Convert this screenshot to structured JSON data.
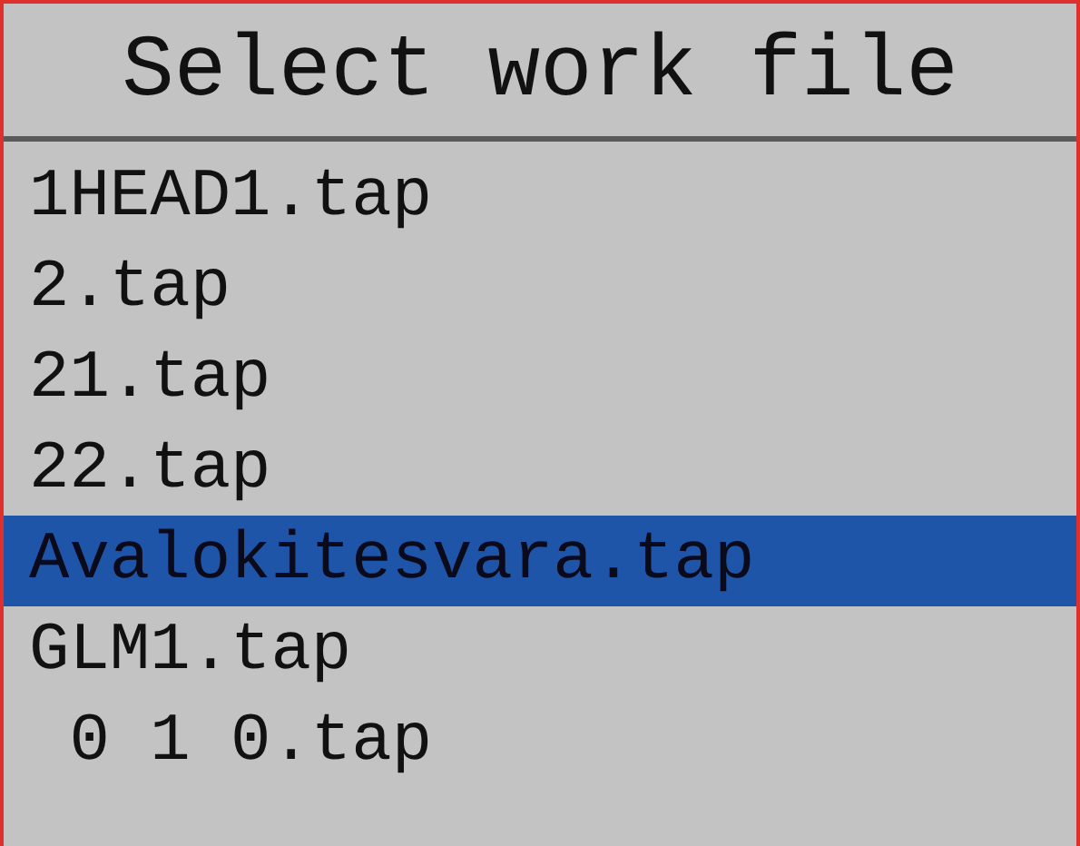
{
  "title": "Select work file",
  "files": [
    {
      "name": "1HEAD1.tap",
      "selected": false
    },
    {
      "name": "2.tap",
      "selected": false
    },
    {
      "name": "21.tap",
      "selected": false
    },
    {
      "name": "22.tap",
      "selected": false
    },
    {
      "name": "Avalokitesvara.tap",
      "selected": true
    },
    {
      "name": "GLM1.tap",
      "selected": false
    },
    {
      "name": " 0 1 0.tap",
      "selected": false
    }
  ]
}
